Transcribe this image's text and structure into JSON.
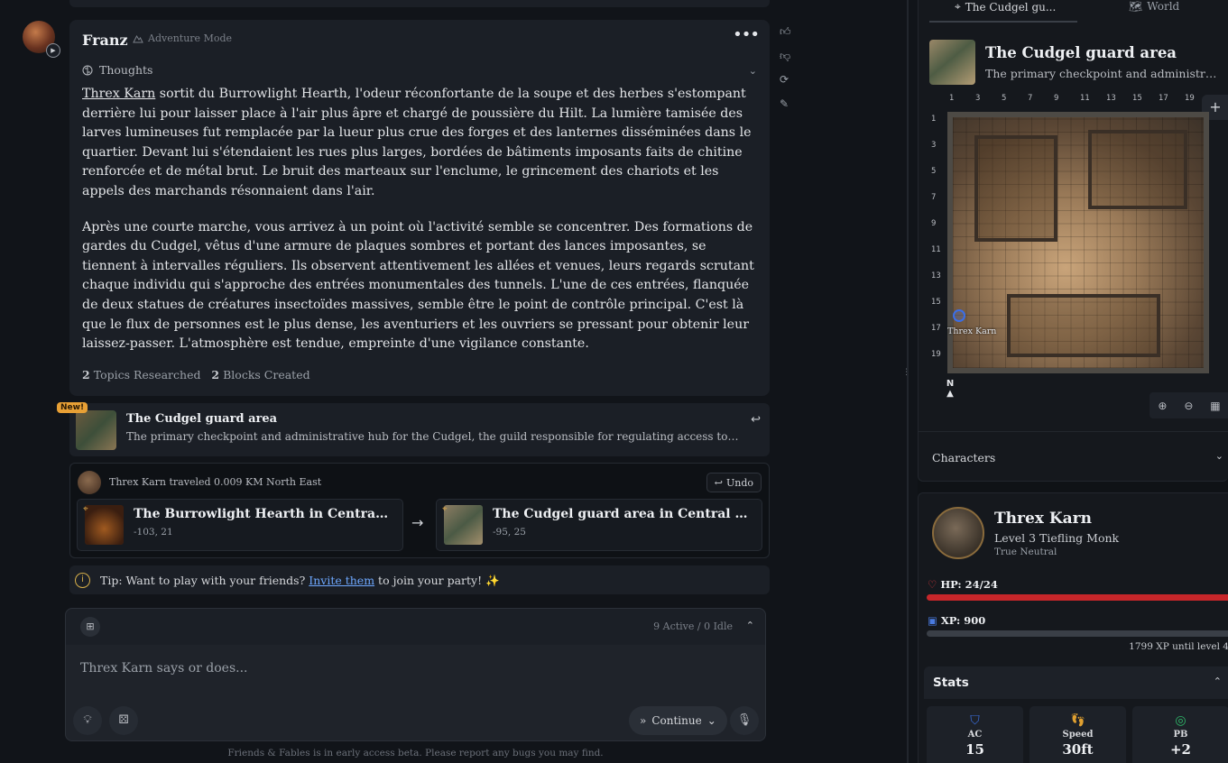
{
  "message": {
    "author": "Franz",
    "mode": "Adventure Mode",
    "thoughts_label": "Thoughts",
    "story_link": "Threx Karn",
    "paragraph1_rest": " sortit du Burrowlight Hearth, l'odeur réconfortante de la soupe et des herbes s'estompant derrière lui pour laisser place à l'air plus âpre et chargé de poussière du Hilt. La lumière tamisée des larves lumineuses fut remplacée par la lueur plus crue des forges et des lanternes disséminées dans le quartier. Devant lui s'étendaient les rues plus larges, bordées de bâtiments imposants faits de chitine renforcée et de métal brut. Le bruit des marteaux sur l'enclume, le grincement des chariots et les appels des marchands résonnaient dans l'air.",
    "paragraph2": "Après une courte marche, vous arrivez à un point où l'activité semble se concentrer. Des formations de gardes du Cudgel, vêtus d'une armure de plaques sombres et portant des lances imposantes, se tiennent à intervalles réguliers. Ils observent attentivement les allées et venues, leurs regards scrutant chaque individu qui s'approche des entrées monumentales des tunnels. L'une de ces entrées, flanquée de deux statues de créatures insectoïdes massives, semble être le point de contrôle principal. C'est là que le flux de personnes est le plus dense, les aventuriers et les ouvriers se pressant pour obtenir leur laissez-passer. L'atmosphère est tendue, empreinte d'une vigilance constante.",
    "topics_count": "2",
    "topics_label": "Topics Researched",
    "blocks_count": "2",
    "blocks_label": "Blocks Created"
  },
  "location_card": {
    "badge": "New!",
    "title": "The Cudgel guard area",
    "description": "The primary checkpoint and administrative hub for the Cudgel, the guild responsible for regulating access to the..."
  },
  "travel": {
    "text": "Threx Karn traveled 0.009 KM North East",
    "undo_label": "Undo",
    "from": {
      "name": "The Burrowlight Hearth in Central The...",
      "coords": "-103, 21"
    },
    "to": {
      "name": "The Cudgel guard area in Central The Hilt",
      "coords": "-95, 25"
    }
  },
  "tip": {
    "prefix": "Tip: Want to play with your friends?",
    "link": "Invite them",
    "suffix": "to join your party! ✨"
  },
  "composer": {
    "active_status": "9 Active / 0 Idle",
    "placeholder": "Threx Karn says or does...",
    "continue_label": "Continue"
  },
  "footer_note": "Friends & Fables is in early access beta. Please report any bugs you may find.",
  "map": {
    "tab_location": "The Cudgel gu...",
    "tab_world": "World",
    "location_title": "The Cudgel guard area",
    "location_desc": "The primary checkpoint and administrativ...",
    "col_labels": [
      "1",
      "3",
      "5",
      "7",
      "9",
      "11",
      "13",
      "15",
      "17",
      "19"
    ],
    "row_labels": [
      "1",
      "3",
      "5",
      "7",
      "9",
      "11",
      "13",
      "15",
      "17",
      "19"
    ],
    "token_label": "Threx Karn",
    "compass": "N",
    "characters_label": "Characters"
  },
  "character": {
    "name": "Threx Karn",
    "class_line": "Level 3 Tiefling Monk",
    "alignment": "True Neutral",
    "hp_label": "HP: 24/24",
    "hp_fraction": 1.0,
    "xp_label": "XP: 900",
    "xp_fraction": 0.0,
    "xp_remaining": "1799 XP until level 4",
    "stats_title": "Stats",
    "stats": [
      {
        "label": "AC",
        "value": "15",
        "icon": "shield-icon",
        "color": "#3b6fe0"
      },
      {
        "label": "Speed",
        "value": "30ft",
        "icon": "footprints-icon",
        "color": "#e0a030"
      },
      {
        "label": "PB",
        "value": "+2",
        "icon": "target-icon",
        "color": "#2fb86a"
      }
    ]
  }
}
